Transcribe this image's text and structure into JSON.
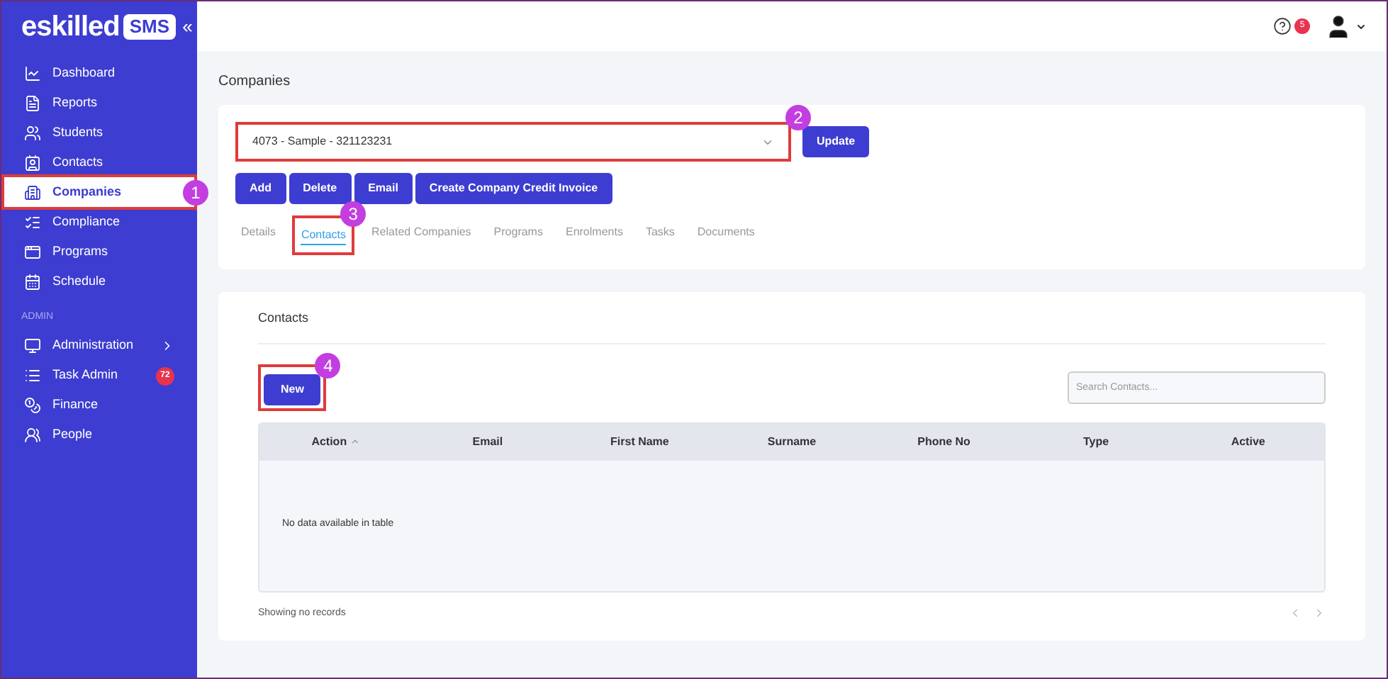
{
  "sidebar": {
    "logo": {
      "word": "eskilled",
      "badge": "SMS"
    },
    "collapse": "«",
    "items": [
      {
        "label": "Dashboard",
        "selected": false
      },
      {
        "label": "Reports",
        "selected": false
      },
      {
        "label": "Students",
        "selected": false
      },
      {
        "label": "Contacts",
        "selected": false
      },
      {
        "label": "Companies",
        "selected": true,
        "callout": "1"
      },
      {
        "label": "Compliance",
        "selected": false
      },
      {
        "label": "Programs",
        "selected": false
      },
      {
        "label": "Schedule",
        "selected": false
      }
    ],
    "admin_heading": "ADMIN",
    "admin_items": [
      {
        "label": "Administration",
        "selected": false,
        "submenu": true
      },
      {
        "label": "Task Admin",
        "selected": false,
        "badge": "72"
      },
      {
        "label": "Finance",
        "selected": false
      },
      {
        "label": "People",
        "selected": false
      }
    ]
  },
  "topbar": {
    "notifications": "5"
  },
  "page_title": "Companies",
  "company_select": {
    "value": "4073 - Sample - 321123231",
    "callout": "2"
  },
  "update_button": "Update",
  "actions": [
    "Add",
    "Delete",
    "Email",
    "Create Company Credit Invoice"
  ],
  "tabs": [
    {
      "label": "Details",
      "selected": false
    },
    {
      "label": "Contacts",
      "selected": true,
      "callout": "3"
    },
    {
      "label": "Related Companies",
      "selected": false
    },
    {
      "label": "Programs",
      "selected": false
    },
    {
      "label": "Enrolments",
      "selected": false
    },
    {
      "label": "Tasks",
      "selected": false
    },
    {
      "label": "Documents",
      "selected": false
    }
  ],
  "contacts": {
    "title": "Contacts",
    "new_button": {
      "label": "New",
      "callout": "4"
    },
    "search": {
      "placeholder": "Search Contacts..."
    },
    "table": {
      "columns": [
        {
          "label": "Action",
          "sorted": true
        },
        {
          "label": "Email",
          "sorted": false
        },
        {
          "label": "First Name",
          "sorted": false
        },
        {
          "label": "Surname",
          "sorted": false
        },
        {
          "label": "Phone No",
          "sorted": false
        },
        {
          "label": "Type",
          "sorted": false
        },
        {
          "label": "Active",
          "sorted": false
        }
      ],
      "empty": "No data available in table"
    },
    "footer": "Showing no records"
  }
}
